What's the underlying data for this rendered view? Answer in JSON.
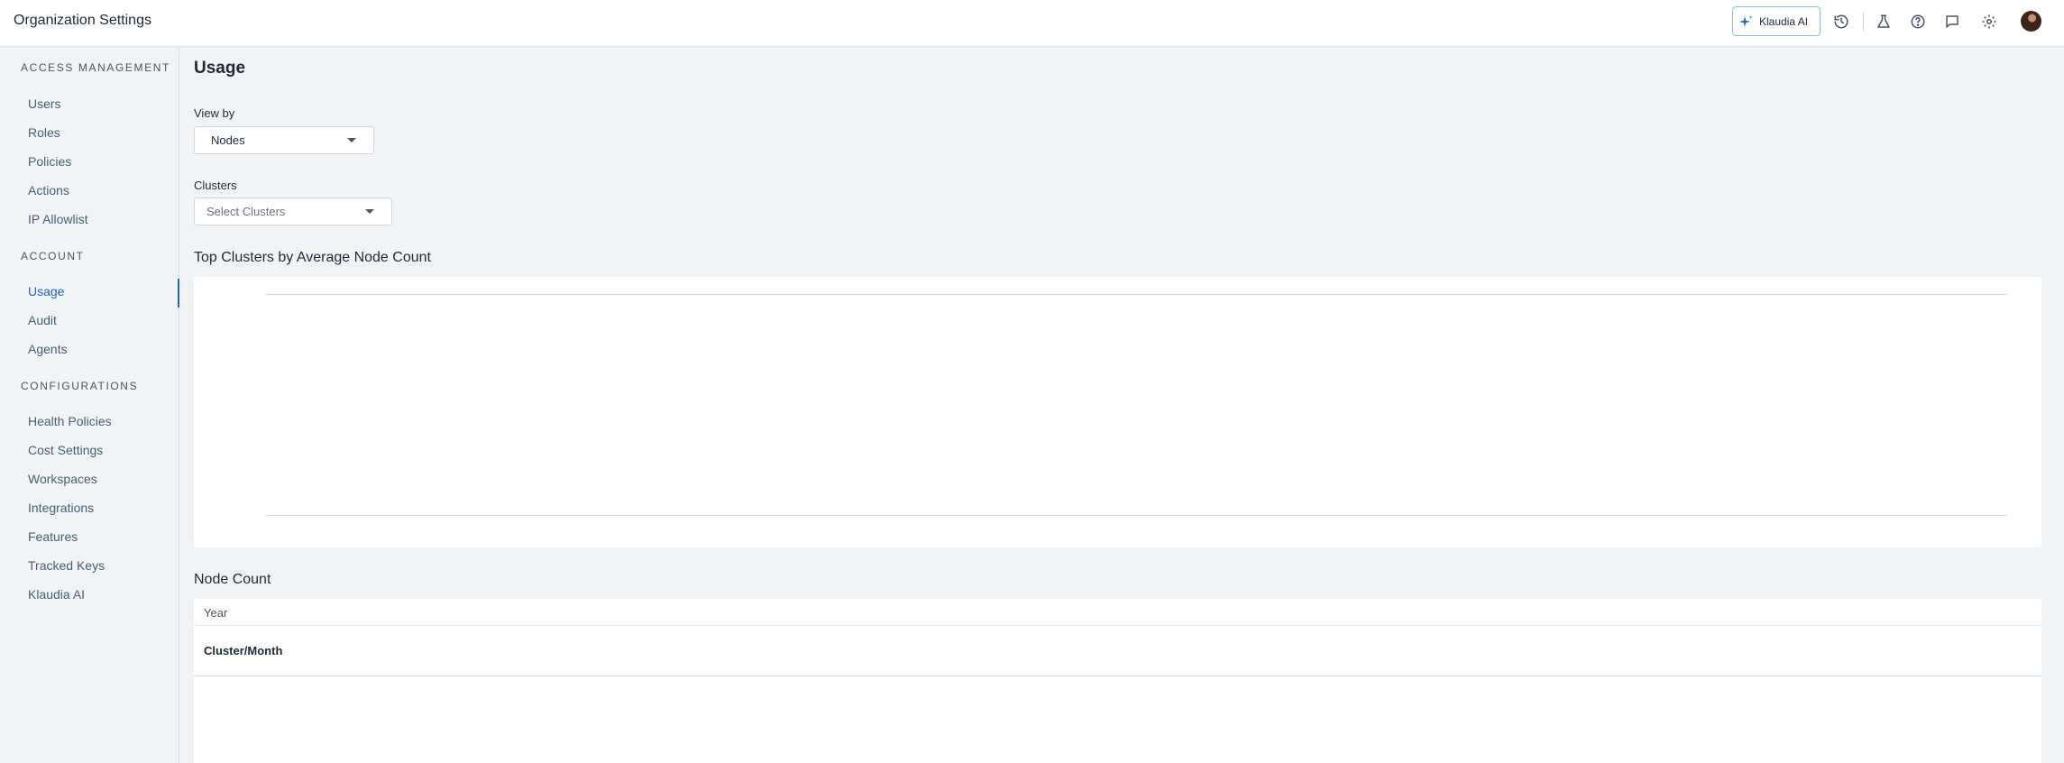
{
  "header": {
    "title": "Organization Settings",
    "ai_button_label": "Klaudia AI",
    "icons": [
      "history-icon",
      "flask-icon",
      "help-icon",
      "chat-icon",
      "gear-icon"
    ]
  },
  "sidebar": {
    "sections": [
      {
        "title": "ACCESS MANAGEMENT",
        "items": [
          "Users",
          "Roles",
          "Policies",
          "Actions",
          "IP Allowlist"
        ]
      },
      {
        "title": "ACCOUNT",
        "items": [
          "Usage",
          "Audit",
          "Agents"
        ]
      },
      {
        "title": "CONFIGURATIONS",
        "items": [
          "Health Policies",
          "Cost Settings",
          "Workspaces",
          "Integrations",
          "Features",
          "Tracked Keys",
          "Klaudia AI"
        ]
      }
    ],
    "active_item": "Usage"
  },
  "main": {
    "title": "Usage",
    "view_by": {
      "label": "View by",
      "value": "Nodes"
    },
    "clusters": {
      "label": "Clusters",
      "placeholder": "Select Clusters"
    },
    "chart_title": "Top Clusters by Average Node Count",
    "table": {
      "title": "Node Count",
      "header": "Year",
      "row_label": "Cluster/Month"
    }
  },
  "colors": {
    "accent": "#2563c9",
    "ai_border": "#7dc4d6"
  }
}
